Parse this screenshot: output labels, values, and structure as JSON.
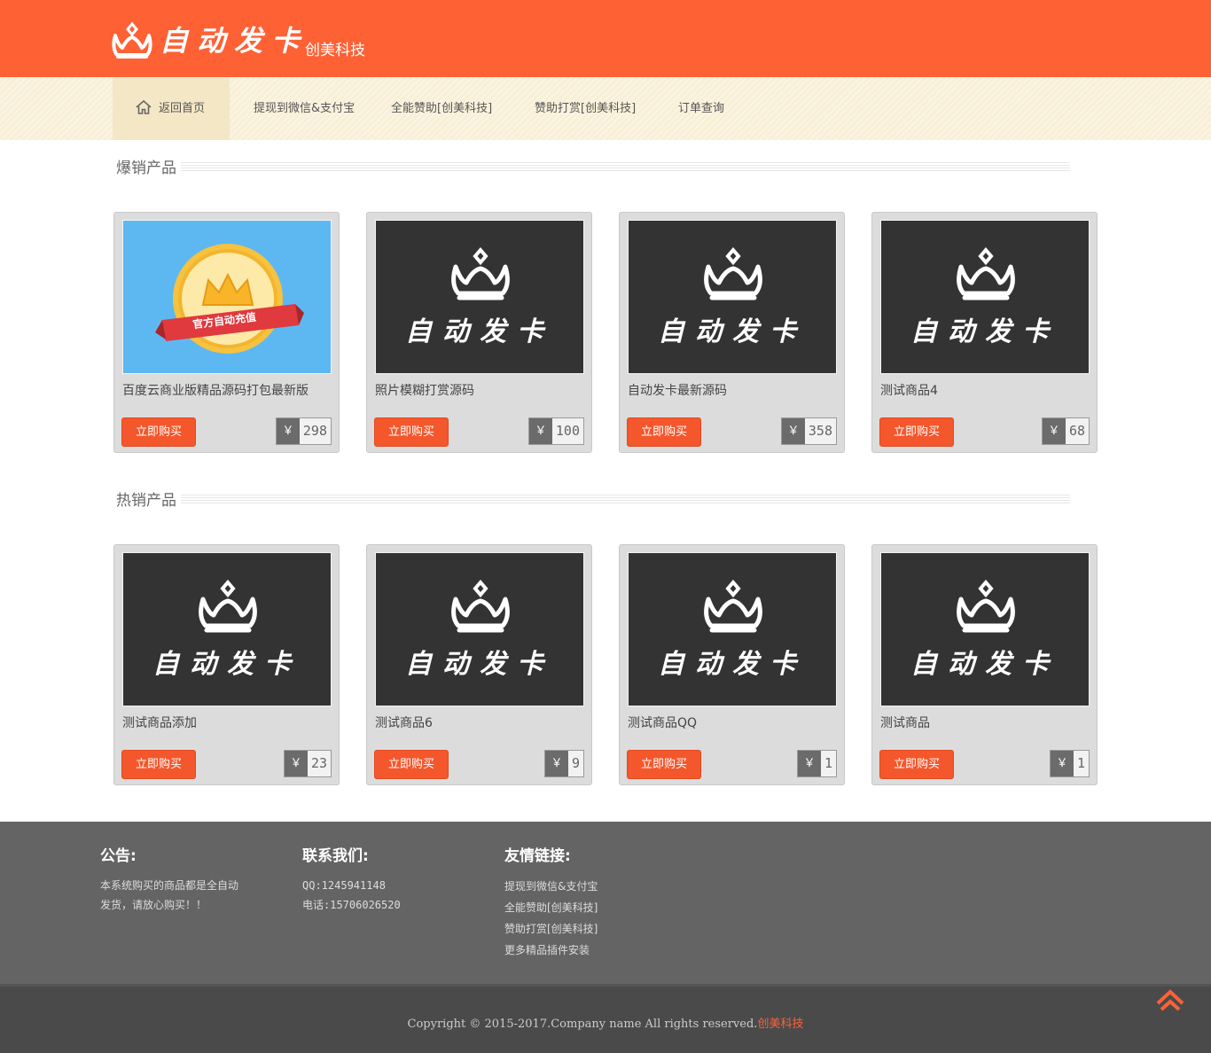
{
  "header": {
    "logo_text": "自动发卡",
    "logo_sub": "创美科技"
  },
  "nav": {
    "items": [
      {
        "label": "返回首页",
        "icon": "home-icon",
        "active": true
      },
      {
        "label": "提现到微信&支付宝"
      },
      {
        "label": "全能赞助[创美科技]"
      },
      {
        "label": "赞助打赏[创美科技]"
      },
      {
        "label": "订单查询"
      }
    ]
  },
  "sections": [
    {
      "title": "爆销产品",
      "products": [
        {
          "name": "百度云商业版精品源码打包最新版",
          "price": "298",
          "image": "official-recharge-badge",
          "image_text": "官方自动充值",
          "buy_label": "立即购买"
        },
        {
          "name": "照片模糊打赏源码",
          "price": "100",
          "image": "auto-card-placeholder",
          "image_text": "自动发卡",
          "buy_label": "立即购买"
        },
        {
          "name": "自动发卡最新源码",
          "price": "358",
          "image": "auto-card-placeholder",
          "image_text": "自动发卡",
          "buy_label": "立即购买"
        },
        {
          "name": "测试商品4",
          "price": "68",
          "image": "auto-card-placeholder",
          "image_text": "自动发卡",
          "buy_label": "立即购买"
        }
      ]
    },
    {
      "title": "热销产品",
      "products": [
        {
          "name": "测试商品添加",
          "price": "23",
          "image": "auto-card-placeholder",
          "image_text": "自动发卡",
          "buy_label": "立即购买"
        },
        {
          "name": "测试商品6",
          "price": "9",
          "image": "auto-card-placeholder",
          "image_text": "自动发卡",
          "buy_label": "立即购买"
        },
        {
          "name": "测试商品QQ",
          "price": "1",
          "image": "auto-card-placeholder",
          "image_text": "自动发卡",
          "buy_label": "立即购买"
        },
        {
          "name": "测试商品",
          "price": "1",
          "image": "auto-card-placeholder",
          "image_text": "自动发卡",
          "buy_label": "立即购买"
        }
      ]
    }
  ],
  "currency_symbol": "￥",
  "footer": {
    "notice": {
      "title": "公告:",
      "lines": [
        "本系统购买的商品都是全自动",
        "发货，请放心购买！！"
      ]
    },
    "contact": {
      "title": "联系我们:",
      "qq": "QQ:1245941148",
      "phone": "电话:15706026520"
    },
    "links": {
      "title": "友情链接:",
      "items": [
        "提现到微信&支付宝",
        "全能赞助[创美科技]",
        "赞助打赏[创美科技]",
        "更多精品插件安装"
      ]
    }
  },
  "copyright": {
    "text": "Copyright © 2015-2017.Company name All rights reserved.",
    "brand": "创美科技"
  },
  "colors": {
    "brand": "#fe6134",
    "nav_bg": "#f8efd6",
    "footer_bg": "#646464",
    "bottom_bg": "#4a4a4a",
    "buy_button": "#f4572c"
  }
}
